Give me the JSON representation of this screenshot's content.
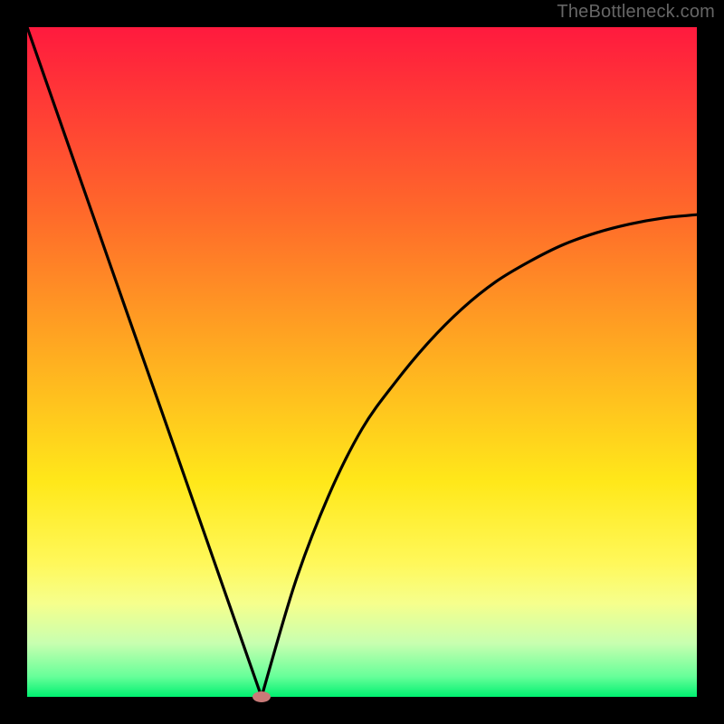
{
  "watermark": "TheBottleneck.com",
  "chart_data": {
    "type": "line",
    "title": "",
    "xlabel": "",
    "ylabel": "",
    "xlim": [
      0,
      100
    ],
    "ylim": [
      0,
      100
    ],
    "curve": {
      "name": "bottleneck-curve",
      "x_min_point": 35,
      "left_start_y": 100,
      "right_end_y": 72,
      "x": [
        0,
        5,
        10,
        15,
        20,
        25,
        30,
        35,
        40,
        45,
        50,
        55,
        60,
        65,
        70,
        75,
        80,
        85,
        90,
        95,
        100
      ],
      "y": [
        100,
        85.7,
        71.4,
        57.1,
        42.9,
        28.6,
        14.3,
        0,
        17,
        30,
        40,
        47,
        53,
        58,
        62,
        65,
        67.5,
        69.3,
        70.6,
        71.5,
        72
      ]
    },
    "marker": {
      "x": 35,
      "y": 0,
      "color": "#c97a78"
    },
    "background_gradient": {
      "stops": [
        {
          "pos": 0,
          "color": "#ff1a3e"
        },
        {
          "pos": 50,
          "color": "#ffb020"
        },
        {
          "pos": 80,
          "color": "#fff85a"
        },
        {
          "pos": 100,
          "color": "#00f070"
        }
      ]
    }
  }
}
